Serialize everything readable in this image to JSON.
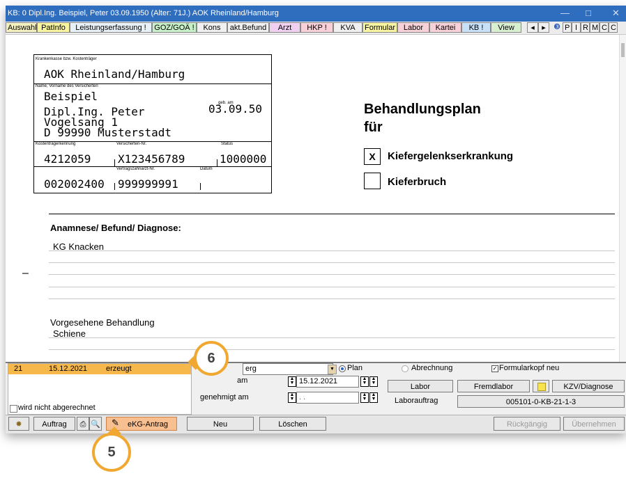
{
  "window": {
    "title": "KB: 0  Dipl.Ing. Beispiel, Peter  03.09.1950 (Alter: 71J.)  AOK Rheinland/Hamburg",
    "minimize": "—",
    "maximize": "□",
    "close": "✕"
  },
  "toolbar": {
    "tabs": [
      "Auswahl",
      "PatInfo",
      "Leistungserfassung !",
      "GOZ/GOÄ !",
      "Kons",
      "akt.Befund",
      "Arzt",
      "HKP !",
      "KVA",
      "Formular",
      "Labor",
      "Kartei",
      "KB !",
      "View"
    ],
    "nav_prev": "◂",
    "nav_next": "▸",
    "help": "❸",
    "letters": [
      "P",
      "I",
      "R",
      "M",
      "C",
      "C"
    ]
  },
  "card": {
    "insurer_label": "Krankenkasse bzw. Kostenträger",
    "insurer": "AOK Rheinland/Hamburg",
    "name_label": "Name, Vorname des Versicherten",
    "surname": "Beispiel",
    "firstname": "Dipl.Ing. Peter",
    "dob_label": "geb. am",
    "dob": "03.09.50",
    "street": "Vogelsang 1",
    "city": "D 99990 Musterstadt",
    "kt_label": "Kostenträgerkennung",
    "vn_label": "Versicherten-Nr.",
    "status_label": "Status",
    "kt": "4212059",
    "vn": "X123456789",
    "status": "1000000",
    "vz_label": "Vertragszahnarzt-Nr.",
    "datum_label": "Datum",
    "bsnr": "002002400",
    "vznr": "999999991"
  },
  "plan": {
    "heading_line1": "Behandlungsplan",
    "heading_line2": "für",
    "option1_mark": "X",
    "option1": "Kiefergelenkserkrankung",
    "option2": "Kieferbruch"
  },
  "anamnese": {
    "heading": "Anamnese/ Befund/ Diagnose:",
    "text": "KG Knacken"
  },
  "behandlung": {
    "heading": "Vorgesehene Behandlung",
    "text": "Schiene"
  },
  "left_marker": "–",
  "record": {
    "num": "21",
    "date": "15.12.2021",
    "status": "erzeugt",
    "not_billed_label": "wird nicht abgerechnet"
  },
  "form": {
    "dropdown_value": "erg",
    "radio_plan": "Plan",
    "radio_abrechnung": "Abrechnung",
    "checkbox_formularkopf": "Formularkopf neu",
    "erstellt_label": "am",
    "erstellt_date": "15.12.2021",
    "genehmigt_label": "genehmigt am",
    "genehmigt_date": ". .",
    "labor_button": "Labor",
    "fremdlabor_button": "Fremdlabor",
    "kzv_button": "KZV/Diagnose",
    "laborauftrag_label": "Laborauftrag",
    "laborauftrag_value": "005101-0-KB-21-1-3"
  },
  "bottom": {
    "auftrag": "Auftrag",
    "ekg": "eKG-Antrag",
    "neu": "Neu",
    "loeschen": "Löschen",
    "rueckgaengig": "Rückgängig",
    "uebernehmen": "Übernehmen"
  },
  "callouts": {
    "five": "5",
    "six": "6"
  },
  "colors": {
    "titlebar": "#2f6dbf",
    "record_row": "#f7b84b",
    "callout_border": "#f0a830"
  }
}
